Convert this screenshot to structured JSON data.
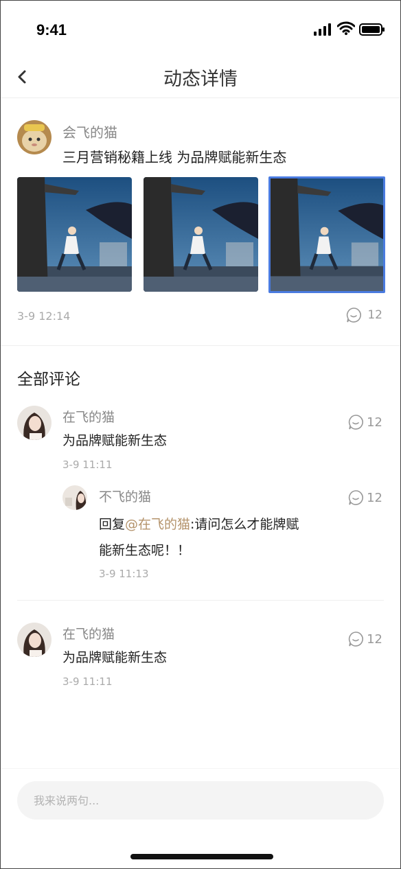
{
  "status_bar": {
    "time": "9:41"
  },
  "nav": {
    "title": "动态详情"
  },
  "post": {
    "author": "会飞的猫",
    "text": "三月营销秘籍上线 为品牌赋能新生态",
    "time": "3-9 12:14",
    "comment_count": "12",
    "photos": [
      "photo-1",
      "photo-2",
      "photo-3"
    ]
  },
  "comments": {
    "section_title": "全部评论",
    "items": [
      {
        "name": "在飞的猫",
        "text": "为品牌赋能新生态",
        "time": "3-9 11:11",
        "count": "12"
      },
      {
        "name": "在飞的猫",
        "text": "为品牌赋能新生态",
        "time": "3-9 11:11",
        "count": "12"
      }
    ],
    "reply": {
      "name": "不飞的猫",
      "prefix": "回复",
      "mention": "@在飞的猫",
      "text_line1": ":请问怎么才能牌赋",
      "text_line2": "能新生态呢！！",
      "time": "3-9 11:13",
      "count": "12"
    }
  },
  "input": {
    "placeholder": "我来说两句..."
  },
  "colors": {
    "accent": "#4a7be0",
    "mention": "#b4936b"
  }
}
